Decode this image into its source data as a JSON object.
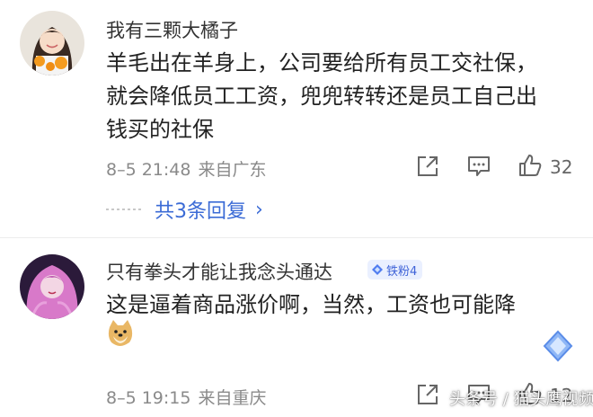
{
  "comments": [
    {
      "username": "我有三颗大橘子",
      "body_lines": [
        "羊毛出在羊身上，公司要给所有员工交社保，",
        "就会降低员工工资，兜兜转转还是员工自己出",
        "钱买的社保"
      ],
      "timestamp": "8–5 21:48",
      "location": "来自广东",
      "like_count": "32",
      "replies_label": "共3条回复",
      "avatar_icon": "girl-with-oranges-avatar"
    },
    {
      "username": "只有拳头才能让我念头通达",
      "fan_badge": "铁粉4",
      "body_lines": [
        "这是逼着商品涨价啊，当然，工资也可能降"
      ],
      "emoji": "doge-emoji",
      "timestamp": "8–5 19:15",
      "location": "来自重庆",
      "like_count": "12",
      "avatar_icon": "pink-hair-avatar"
    }
  ],
  "watermark": "头条号 / 猫头鹰视频",
  "colors": {
    "accent": "#3b6bd6",
    "meta": "#8a8a8a",
    "badge_bg": "#eaf0ff"
  }
}
